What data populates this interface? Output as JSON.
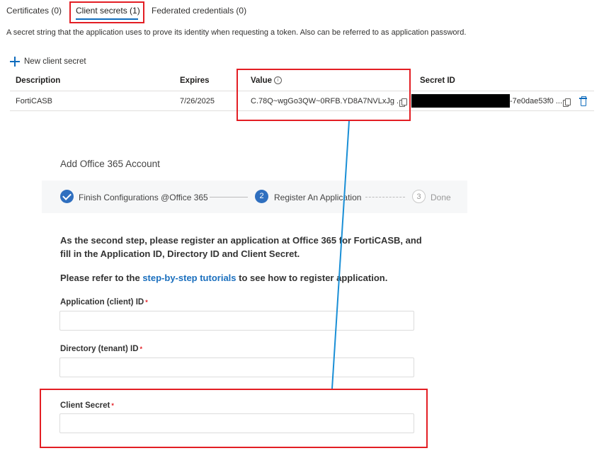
{
  "tabs": [
    {
      "label": "Certificates (0)"
    },
    {
      "label": "Client secrets (1)"
    },
    {
      "label": "Federated credentials (0)"
    }
  ],
  "description": "A secret string that the application uses to prove its identity when requesting a token. Also can be referred to as application password.",
  "new_secret_label": "New client secret",
  "table": {
    "headers": {
      "description": "Description",
      "expires": "Expires",
      "value": "Value",
      "secret_id": "Secret ID"
    },
    "rows": [
      {
        "description": "FortiCASB",
        "expires": "7/26/2025",
        "value": "C.78Q~wgGo3QW~0RFB.YD8A7NVLxJg  ...",
        "secret_id": "-7e0dae53f0 ..."
      }
    ]
  },
  "forticasb": {
    "title": "Add Office 365 Account",
    "steps": [
      {
        "label": "Finish Configurations @Office 365",
        "state": "done"
      },
      {
        "number": "2",
        "label": "Register An Application",
        "state": "active"
      },
      {
        "number": "3",
        "label": "Done",
        "state": "pending"
      }
    ],
    "intro_line1": "As the second step, please register an application at Office 365 for FortiCASB, and",
    "intro_line2": "fill in the Application ID, Directory ID and Client Secret.",
    "refer_prefix": "Please refer to the ",
    "refer_link": "step-by-step tutorials",
    "refer_suffix": " to see how to register application.",
    "fields": {
      "app_id": {
        "label": "Application (client) ID",
        "value": ""
      },
      "tenant_id": {
        "label": "Directory (tenant) ID",
        "value": ""
      },
      "client_secret": {
        "label": "Client Secret",
        "value": ""
      }
    },
    "required_mark": "*"
  },
  "colors": {
    "accent": "#0f6cbd",
    "highlight": "#e31e24",
    "step_blue": "#2f6fbf",
    "connector": "#1a8fd6"
  }
}
